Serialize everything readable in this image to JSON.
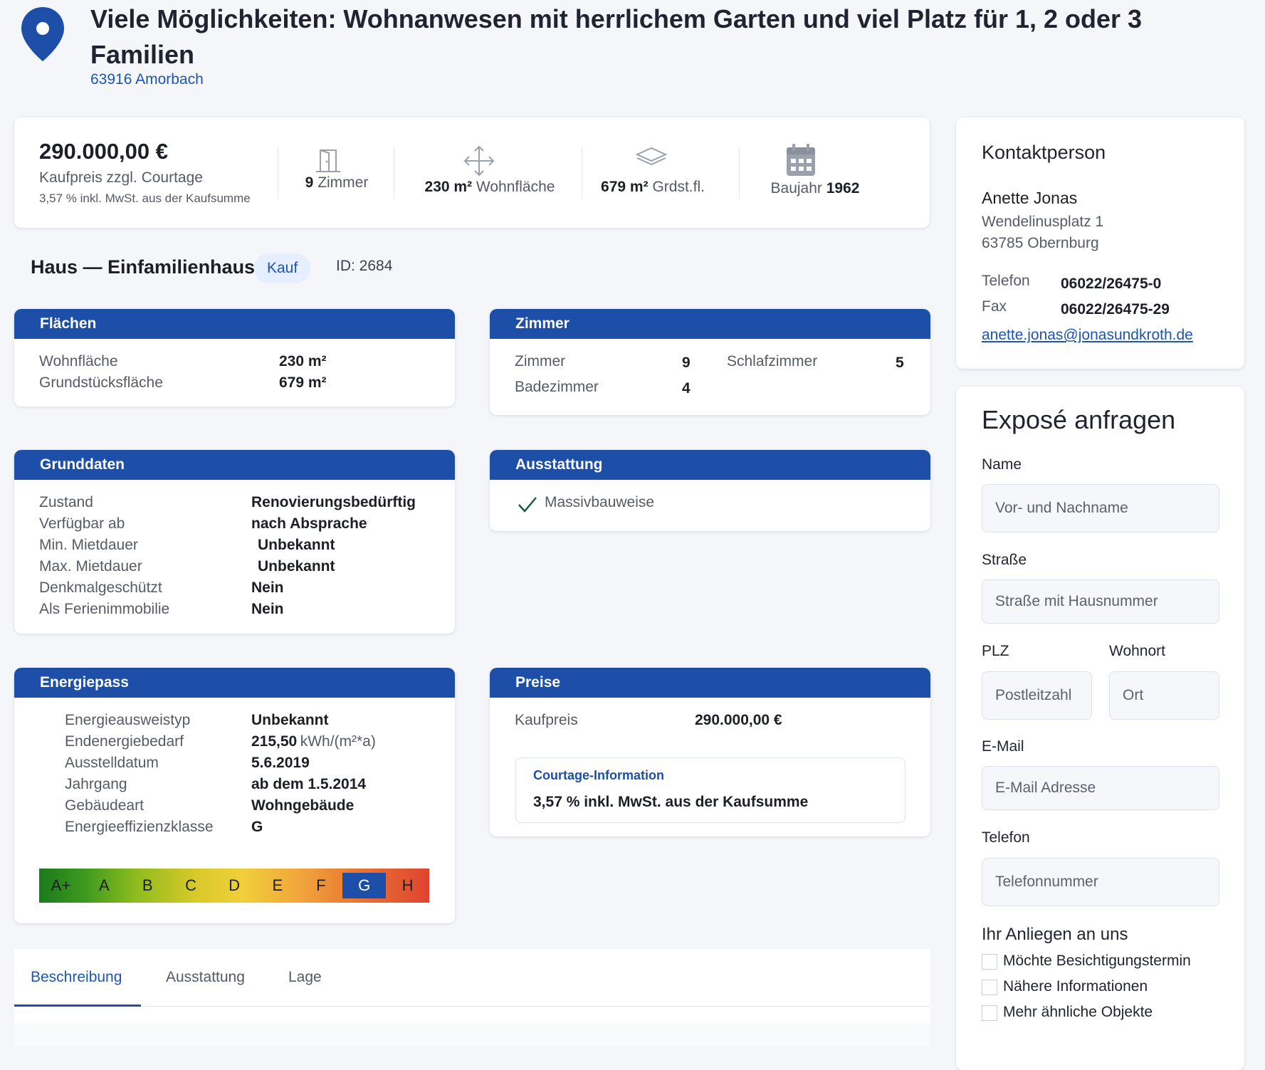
{
  "title": "Viele Möglichkeiten: Wohnanwesen mit herrlichem Garten und viel Platz für 1, 2 oder 3 Familien",
  "location": "63916 Amorbach",
  "keyfacts": {
    "price": "290.000,00 €",
    "price_label": "Kaufpreis zzgl. Courtage",
    "price_note": "3,57 % inkl. MwSt. aus der Kaufsumme",
    "rooms_value": "9",
    "rooms_label": "Zimmer",
    "living_value": "230 m²",
    "living_label": "Wohnfläche",
    "plot_value": "679 m²",
    "plot_label": "Grdst.fl.",
    "year_label": "Baujahr",
    "year_value": "1962"
  },
  "type": {
    "title": "Haus — Einfamilienhaus",
    "badge": "Kauf",
    "id": "ID: 2684"
  },
  "flaechen": {
    "header": "Flächen",
    "rows": [
      {
        "label": "Wohnfläche",
        "value": "230 m²"
      },
      {
        "label": "Grundstücksfläche",
        "value": "679 m²"
      }
    ]
  },
  "zimmer": {
    "header": "Zimmer",
    "zimmer_label": "Zimmer",
    "zimmer_value": "9",
    "schlaf_label": "Schlafzimmer",
    "schlaf_value": "5",
    "bad_label": "Badezimmer",
    "bad_value": "4"
  },
  "grunddaten": {
    "header": "Grunddaten",
    "rows": [
      {
        "label": "Zustand",
        "value": "Renovierungsbedürftig"
      },
      {
        "label": "Verfügbar ab",
        "value": "nach Absprache"
      },
      {
        "label": "Min. Mietdauer",
        "value": "Unbekannt"
      },
      {
        "label": "Max. Mietdauer",
        "value": "Unbekannt"
      },
      {
        "label": "Denkmalgeschützt",
        "value": "Nein"
      },
      {
        "label": "Als Ferienimmobilie",
        "value": "Nein"
      }
    ]
  },
  "ausstattung": {
    "header": "Ausstattung",
    "item": "Massivbauweise"
  },
  "energiepass": {
    "header": "Energiepass",
    "rows": [
      {
        "label": "Energieausweistyp",
        "value": "Unbekannt"
      },
      {
        "label": "Endenergiebedarf",
        "value": "215,50",
        "unit": "kWh/(m²*a)"
      },
      {
        "label": "Ausstelldatum",
        "value": "5.6.2019"
      },
      {
        "label": "Jahrgang",
        "value": "ab dem 1.5.2014"
      },
      {
        "label": "Gebäudeart",
        "value": "Wohngebäude"
      },
      {
        "label": "Energieeffizienzklasse",
        "value": "G"
      }
    ],
    "classes": [
      "A+",
      "A",
      "B",
      "C",
      "D",
      "E",
      "F",
      "G",
      "H"
    ],
    "active_class": "G"
  },
  "preise": {
    "header": "Preise",
    "kaufpreis_label": "Kaufpreis",
    "kaufpreis_value": "290.000,00 €",
    "courtage_title": "Courtage-Information",
    "courtage_text": "3,57 % inkl. MwSt. aus der Kaufsumme"
  },
  "tabs": [
    "Beschreibung",
    "Ausstattung",
    "Lage"
  ],
  "contact": {
    "header": "Kontaktperson",
    "name": "Anette Jonas",
    "street": "Wendelinusplatz 1",
    "city": "63785 Obernburg",
    "phone_label": "Telefon",
    "phone": "06022/26475-0",
    "fax_label": "Fax",
    "fax": "06022/26475-29",
    "email": "anette.jonas@jonasundkroth.de"
  },
  "form": {
    "header": "Exposé anfragen",
    "name_label": "Name",
    "name_placeholder": "Vor- und Nachname",
    "street_label": "Straße",
    "street_placeholder": "Straße mit Hausnummer",
    "plz_label": "PLZ",
    "plz_placeholder": "Postleitzahl",
    "ort_label": "Wohnort",
    "ort_placeholder": "Ort",
    "email_label": "E-Mail",
    "email_placeholder": "E-Mail Adresse",
    "phone_label": "Telefon",
    "phone_placeholder": "Telefonnummer",
    "anliegen_label": "Ihr Anliegen an uns",
    "options": [
      "Möchte Besichtigungstermin",
      "Nähere Informationen",
      "Mehr ähnliche Objekte"
    ]
  },
  "colors": {
    "primary": "#1e4fa8",
    "link": "#1e55b0",
    "badge_bg": "#e6efff"
  }
}
